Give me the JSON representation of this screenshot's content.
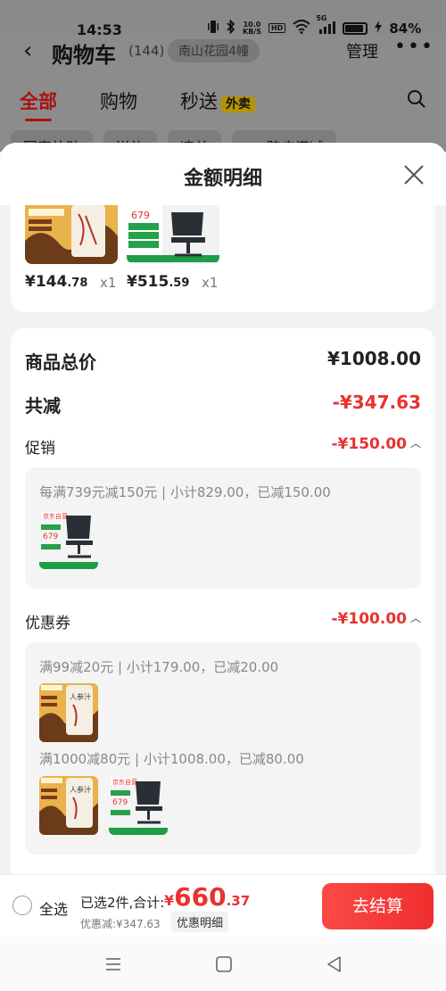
{
  "statusbar": {
    "time": "14:53",
    "net_speed_top": "10.0",
    "net_speed_unit": "KB/S",
    "hd": "HD",
    "signal": "5G",
    "battery": "84%"
  },
  "background_page": {
    "back_glyph": "‹",
    "title": "购物车",
    "count": "(144)",
    "location": "南山花园4幢",
    "manage": "管理",
    "more": "•••",
    "tabs": [
      {
        "label": "全部"
      },
      {
        "label": "购物"
      },
      {
        "label": "秒送",
        "badge": "外卖"
      }
    ],
    "chips": [
      {
        "label": "国家补贴"
      },
      {
        "label": "送礼"
      },
      {
        "label": "凑单"
      },
      {
        "tag": "减",
        "label": "跨店满减"
      }
    ]
  },
  "sheet": {
    "title": "金额明细",
    "close_icon": "close-icon",
    "items": [
      {
        "price_symbol": "¥",
        "price_int": "144",
        "price_dec": ".78",
        "qty": "x1"
      },
      {
        "price_symbol": "¥",
        "price_int": "515",
        "price_dec": ".59",
        "qty": "x1"
      }
    ],
    "thumb_text": {
      "tonic_label": "人参汁",
      "chair_price": "679",
      "badge": "京东自营"
    },
    "goods_total": {
      "label": "商品总价",
      "value": "¥1008.00"
    },
    "total_reduction": {
      "label": "共减",
      "value": "-¥347.63"
    },
    "promotion": {
      "label": "促销",
      "value": "-¥150.00",
      "rules": [
        {
          "text": "每满739元减150元 | 小计829.00，已减150.00"
        }
      ]
    },
    "coupons": {
      "label": "优惠券",
      "value": "-¥100.00",
      "rules": [
        {
          "text": "满99减20元 | 小计179.00，已减20.00"
        },
        {
          "text": "满1000减80元 | 小计1008.00，已减80.00"
        }
      ]
    }
  },
  "bottombar": {
    "select_all": "全选",
    "summary": "已选2件,合计:",
    "total_symbol": "¥",
    "total_int": "660",
    "total_dec": ".37",
    "discount": "优惠减:¥347.63",
    "detail_button": "优惠明细",
    "checkout_button": "去结算"
  },
  "colors": {
    "accent_red": "#e8322f",
    "brand_red": "#f02e2e"
  }
}
